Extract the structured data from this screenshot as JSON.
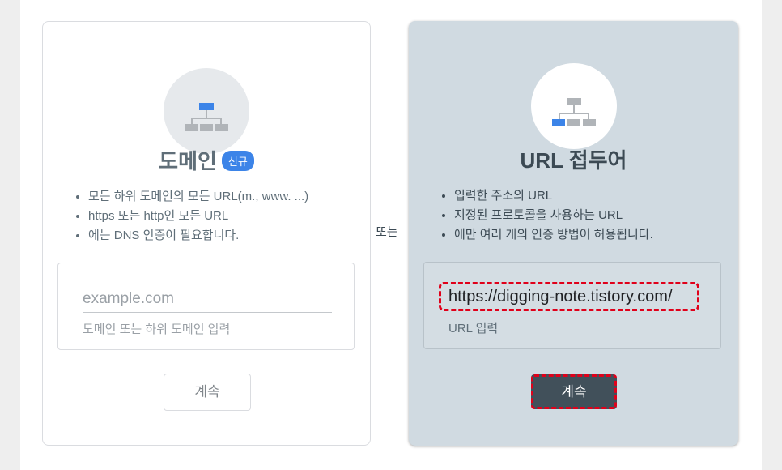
{
  "domain_card": {
    "title": "도메인",
    "badge": "신규",
    "bullets": [
      "모든 하위 도메인의 모든 URL(m., www. ...)",
      "https 또는 http인 모든 URL",
      "에는 DNS 인증이 필요합니다."
    ],
    "input_placeholder": "example.com",
    "input_helper": "도메인 또는 하위 도메인 입력",
    "continue_label": "계속"
  },
  "separator": "또는",
  "url_card": {
    "title": "URL 접두어",
    "bullets": [
      "입력한 주소의 URL",
      "지정된 프로토콜을 사용하는 URL",
      "에만 여러 개의 인증 방법이 허용됩니다."
    ],
    "input_value": "https://digging-note.tistory.com/",
    "input_helper": "URL 입력",
    "continue_label": "계속"
  },
  "colors": {
    "accent_blue": "#3c84e8",
    "highlight_red": "#e0001a",
    "url_card_bg": "#d0dae1",
    "button_dark": "#41505a"
  }
}
